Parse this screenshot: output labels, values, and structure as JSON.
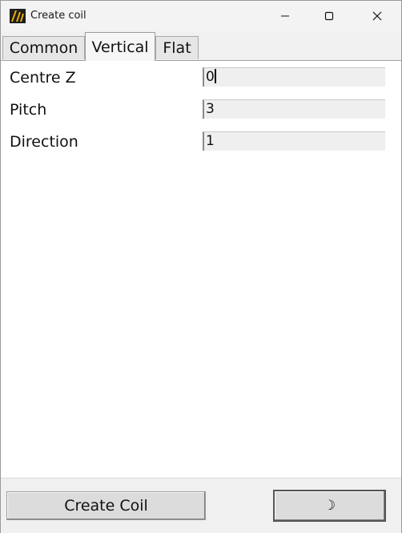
{
  "window": {
    "title": "Create coil",
    "icon": "app-logo-icon",
    "controls": [
      "minimize-icon",
      "maximize-icon",
      "close-icon"
    ]
  },
  "tabs": [
    {
      "label": "Common",
      "active": false
    },
    {
      "label": "Vertical",
      "active": true
    },
    {
      "label": "Flat",
      "active": false
    }
  ],
  "fields": [
    {
      "label": "Centre Z",
      "value": "0",
      "focused": true
    },
    {
      "label": "Pitch",
      "value": "3",
      "focused": false
    },
    {
      "label": "Direction",
      "value": "1",
      "focused": false
    }
  ],
  "buttons": {
    "create_label": "Create Coil",
    "theme_glyph": "☽",
    "theme_icon": "moon-icon"
  },
  "colors": {
    "field_bg": "#efefef",
    "button_bg": "#dcdcdc",
    "titlebar_bg": "#f3f3f3"
  }
}
